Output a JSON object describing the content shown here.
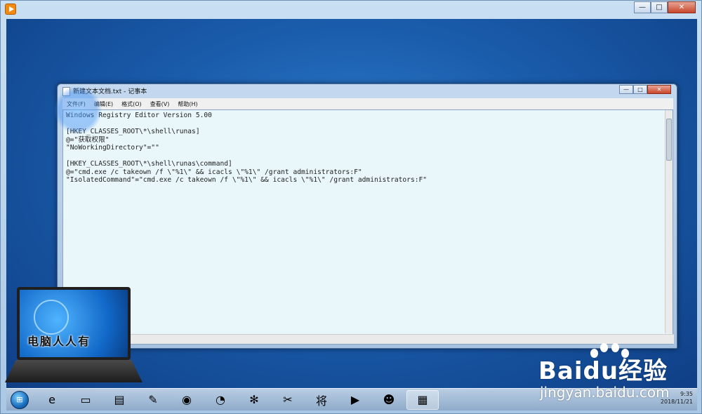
{
  "notepad": {
    "title": "新建文本文档.txt - 记事本",
    "menu": [
      "文件(F)",
      "编辑(E)",
      "格式(O)",
      "查看(V)",
      "帮助(H)"
    ],
    "content": "Windows Registry Editor Version 5.00\n\n[HKEY_CLASSES_ROOT\\*\\shell\\runas]\n@=\"获取权限\"\n\"NoWorkingDirectory\"=\"\"\n\n[HKEY_CLASSES_ROOT\\*\\shell\\runas\\command]\n@=\"cmd.exe /c takeown /f \\\"%1\\\" && icacls \\\"%1\\\" /grant administrators:F\"\n\"IsolatedCommand\"=\"cmd.exe /c takeown /f \\\"%1\\\" && icacls \\\"%1\\\" /grant administrators:F\""
  },
  "window_buttons": {
    "minimize": "—",
    "maximize": "□",
    "close": "✕"
  },
  "taskbar": {
    "items": [
      {
        "icon": "ie-icon",
        "glyph": "e"
      },
      {
        "icon": "folder-icon",
        "glyph": "▭"
      },
      {
        "icon": "explorer-icon",
        "glyph": "▤"
      },
      {
        "icon": "paint-icon",
        "glyph": "✎"
      },
      {
        "icon": "app-icon",
        "glyph": "◉"
      },
      {
        "icon": "browser-icon",
        "glyph": "◔"
      },
      {
        "icon": "pinwheel-icon",
        "glyph": "✻"
      },
      {
        "icon": "tools-icon",
        "glyph": "✂"
      },
      {
        "icon": "chess-icon",
        "glyph": "将"
      },
      {
        "icon": "media-player-icon",
        "glyph": "▶"
      },
      {
        "icon": "puppy-icon",
        "glyph": "☻"
      },
      {
        "icon": "notepad-icon",
        "glyph": "▦"
      }
    ],
    "active_index": 11,
    "time": "9:35",
    "date": "2018/11/21"
  },
  "watermarks": {
    "laptop_logo_text": "电脑人人有",
    "baidu_logo_text": "Baidu经验",
    "baidu_url": "jingyan.baidu.com"
  }
}
